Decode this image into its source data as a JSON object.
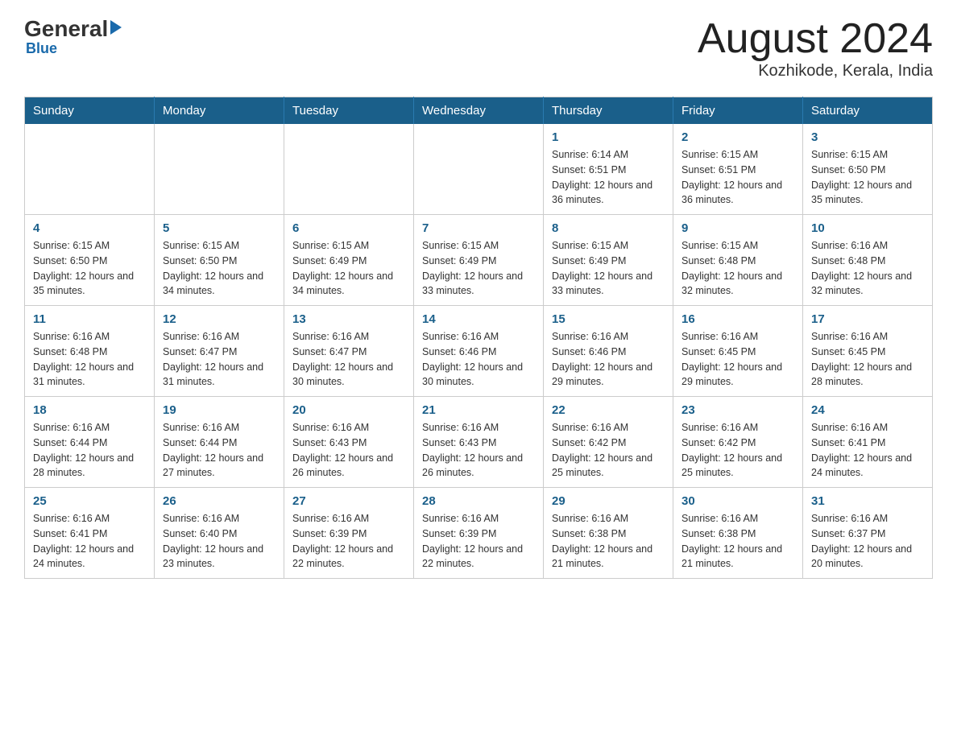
{
  "header": {
    "logo_general": "General",
    "logo_blue": "Blue",
    "title": "August 2024",
    "subtitle": "Kozhikode, Kerala, India"
  },
  "calendar": {
    "days_of_week": [
      "Sunday",
      "Monday",
      "Tuesday",
      "Wednesday",
      "Thursday",
      "Friday",
      "Saturday"
    ],
    "weeks": [
      {
        "days": [
          {
            "number": "",
            "info": ""
          },
          {
            "number": "",
            "info": ""
          },
          {
            "number": "",
            "info": ""
          },
          {
            "number": "",
            "info": ""
          },
          {
            "number": "1",
            "info": "Sunrise: 6:14 AM\nSunset: 6:51 PM\nDaylight: 12 hours and 36 minutes."
          },
          {
            "number": "2",
            "info": "Sunrise: 6:15 AM\nSunset: 6:51 PM\nDaylight: 12 hours and 36 minutes."
          },
          {
            "number": "3",
            "info": "Sunrise: 6:15 AM\nSunset: 6:50 PM\nDaylight: 12 hours and 35 minutes."
          }
        ]
      },
      {
        "days": [
          {
            "number": "4",
            "info": "Sunrise: 6:15 AM\nSunset: 6:50 PM\nDaylight: 12 hours and 35 minutes."
          },
          {
            "number": "5",
            "info": "Sunrise: 6:15 AM\nSunset: 6:50 PM\nDaylight: 12 hours and 34 minutes."
          },
          {
            "number": "6",
            "info": "Sunrise: 6:15 AM\nSunset: 6:49 PM\nDaylight: 12 hours and 34 minutes."
          },
          {
            "number": "7",
            "info": "Sunrise: 6:15 AM\nSunset: 6:49 PM\nDaylight: 12 hours and 33 minutes."
          },
          {
            "number": "8",
            "info": "Sunrise: 6:15 AM\nSunset: 6:49 PM\nDaylight: 12 hours and 33 minutes."
          },
          {
            "number": "9",
            "info": "Sunrise: 6:15 AM\nSunset: 6:48 PM\nDaylight: 12 hours and 32 minutes."
          },
          {
            "number": "10",
            "info": "Sunrise: 6:16 AM\nSunset: 6:48 PM\nDaylight: 12 hours and 32 minutes."
          }
        ]
      },
      {
        "days": [
          {
            "number": "11",
            "info": "Sunrise: 6:16 AM\nSunset: 6:48 PM\nDaylight: 12 hours and 31 minutes."
          },
          {
            "number": "12",
            "info": "Sunrise: 6:16 AM\nSunset: 6:47 PM\nDaylight: 12 hours and 31 minutes."
          },
          {
            "number": "13",
            "info": "Sunrise: 6:16 AM\nSunset: 6:47 PM\nDaylight: 12 hours and 30 minutes."
          },
          {
            "number": "14",
            "info": "Sunrise: 6:16 AM\nSunset: 6:46 PM\nDaylight: 12 hours and 30 minutes."
          },
          {
            "number": "15",
            "info": "Sunrise: 6:16 AM\nSunset: 6:46 PM\nDaylight: 12 hours and 29 minutes."
          },
          {
            "number": "16",
            "info": "Sunrise: 6:16 AM\nSunset: 6:45 PM\nDaylight: 12 hours and 29 minutes."
          },
          {
            "number": "17",
            "info": "Sunrise: 6:16 AM\nSunset: 6:45 PM\nDaylight: 12 hours and 28 minutes."
          }
        ]
      },
      {
        "days": [
          {
            "number": "18",
            "info": "Sunrise: 6:16 AM\nSunset: 6:44 PM\nDaylight: 12 hours and 28 minutes."
          },
          {
            "number": "19",
            "info": "Sunrise: 6:16 AM\nSunset: 6:44 PM\nDaylight: 12 hours and 27 minutes."
          },
          {
            "number": "20",
            "info": "Sunrise: 6:16 AM\nSunset: 6:43 PM\nDaylight: 12 hours and 26 minutes."
          },
          {
            "number": "21",
            "info": "Sunrise: 6:16 AM\nSunset: 6:43 PM\nDaylight: 12 hours and 26 minutes."
          },
          {
            "number": "22",
            "info": "Sunrise: 6:16 AM\nSunset: 6:42 PM\nDaylight: 12 hours and 25 minutes."
          },
          {
            "number": "23",
            "info": "Sunrise: 6:16 AM\nSunset: 6:42 PM\nDaylight: 12 hours and 25 minutes."
          },
          {
            "number": "24",
            "info": "Sunrise: 6:16 AM\nSunset: 6:41 PM\nDaylight: 12 hours and 24 minutes."
          }
        ]
      },
      {
        "days": [
          {
            "number": "25",
            "info": "Sunrise: 6:16 AM\nSunset: 6:41 PM\nDaylight: 12 hours and 24 minutes."
          },
          {
            "number": "26",
            "info": "Sunrise: 6:16 AM\nSunset: 6:40 PM\nDaylight: 12 hours and 23 minutes."
          },
          {
            "number": "27",
            "info": "Sunrise: 6:16 AM\nSunset: 6:39 PM\nDaylight: 12 hours and 22 minutes."
          },
          {
            "number": "28",
            "info": "Sunrise: 6:16 AM\nSunset: 6:39 PM\nDaylight: 12 hours and 22 minutes."
          },
          {
            "number": "29",
            "info": "Sunrise: 6:16 AM\nSunset: 6:38 PM\nDaylight: 12 hours and 21 minutes."
          },
          {
            "number": "30",
            "info": "Sunrise: 6:16 AM\nSunset: 6:38 PM\nDaylight: 12 hours and 21 minutes."
          },
          {
            "number": "31",
            "info": "Sunrise: 6:16 AM\nSunset: 6:37 PM\nDaylight: 12 hours and 20 minutes."
          }
        ]
      }
    ]
  }
}
